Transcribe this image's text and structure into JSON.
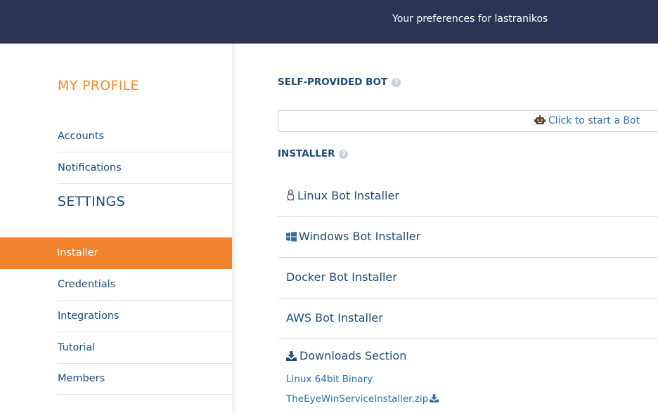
{
  "header": {
    "preferences_text": "Your preferences for lastranikos"
  },
  "sidebar": {
    "profile_title": "MY PROFILE",
    "profile_items": [
      {
        "label": "Accounts"
      },
      {
        "label": "Notifications"
      }
    ],
    "settings_title": "SETTINGS",
    "settings_items": [
      {
        "label": "Installer",
        "active": true
      },
      {
        "label": "Credentials"
      },
      {
        "label": "Integrations"
      },
      {
        "label": "Tutorial"
      },
      {
        "label": "Members"
      }
    ]
  },
  "main": {
    "self_provided": {
      "title": "SELF-PROVIDED BOT",
      "help_icon": "question-circle-icon",
      "start_label": "Click to start a Bot",
      "start_icon": "robot-icon"
    },
    "installer": {
      "title": "INSTALLER",
      "help_icon": "question-circle-icon",
      "items": [
        {
          "label": "Linux Bot Installer",
          "icon": "linux-icon"
        },
        {
          "label": "Windows Bot Installer",
          "icon": "windows-icon"
        },
        {
          "label": "Docker Bot Installer"
        },
        {
          "label": "AWS Bot Installer"
        }
      ]
    },
    "downloads": {
      "title": "Downloads Section",
      "icon": "download-icon",
      "links": [
        {
          "label": "Linux 64bit Binary"
        },
        {
          "label": "TheEyeWinServiceInstaller.zip",
          "icon": "download-icon"
        }
      ]
    }
  },
  "colors": {
    "topbar": "#2b3455",
    "accent_orange": "#f2832e",
    "navy_text": "#1e4a78",
    "link_blue": "#2f6ea8"
  }
}
